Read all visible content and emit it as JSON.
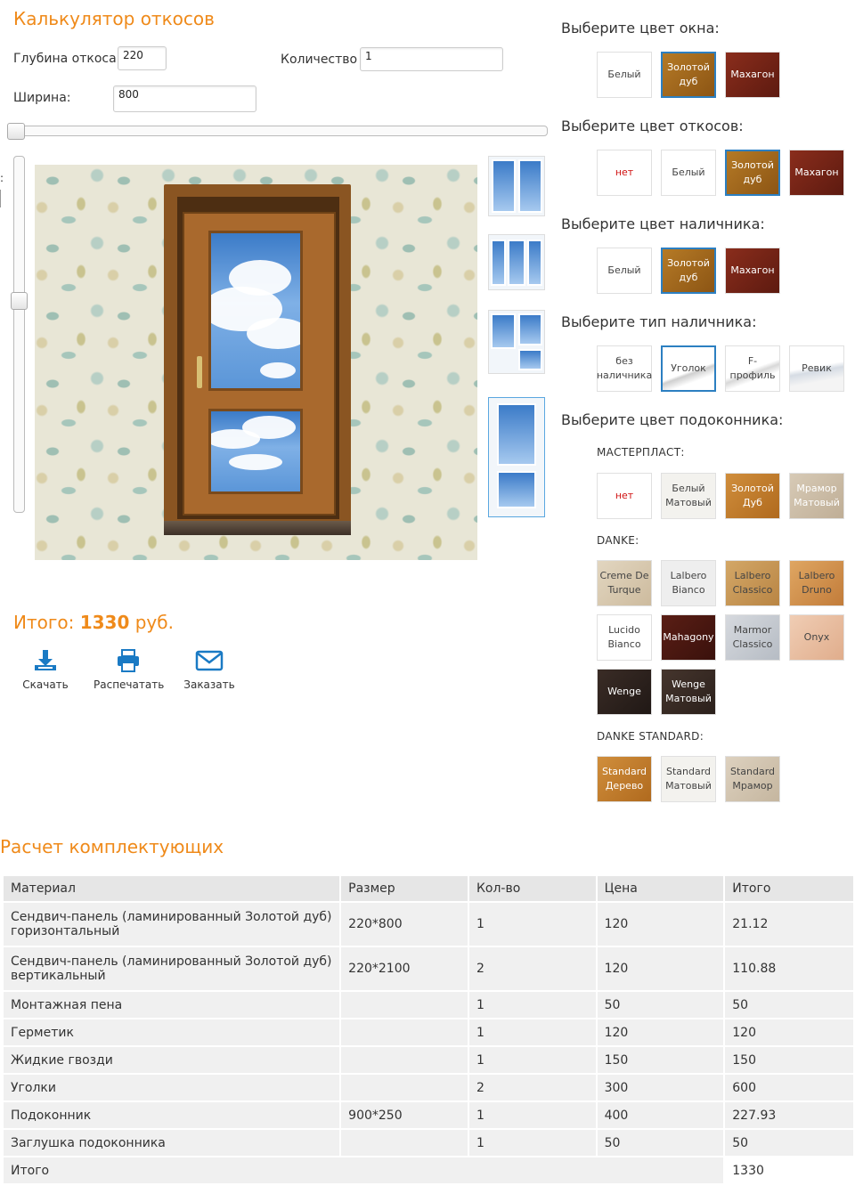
{
  "calculator": {
    "title": "Калькулятор откосов",
    "depth_label": "Глубина откоса",
    "depth_value": "220",
    "quantity_label": "Количество",
    "quantity_value": "1",
    "width_label": "Ширина:",
    "width_value": "800",
    "height_slider_label": ":"
  },
  "totals": {
    "label": "Итого:",
    "amount": "1330",
    "currency": "руб."
  },
  "actions": {
    "download": "Скачать",
    "print": "Распечатать",
    "order": "Заказать"
  },
  "options": {
    "window_color": {
      "title": "Выберите цвет окна:",
      "items": [
        {
          "label": "Белый",
          "color": "#ffffff"
        },
        {
          "label": "Золотой дуб",
          "color": "#a86b1e",
          "selected": true
        },
        {
          "label": "Махагон",
          "color": "#7a2416"
        }
      ]
    },
    "slope_color": {
      "title": "Выберите цвет откосов:",
      "items": [
        {
          "label": "нет",
          "color": "#ffffff"
        },
        {
          "label": "Белый",
          "color": "#ffffff"
        },
        {
          "label": "Золотой дуб",
          "color": "#a86b1e",
          "selected": true
        },
        {
          "label": "Махагон",
          "color": "#7a2416"
        }
      ]
    },
    "trim_color": {
      "title": "Выберите цвет наличника:",
      "items": [
        {
          "label": "Белый",
          "color": "#ffffff"
        },
        {
          "label": "Золотой дуб",
          "color": "#a86b1e",
          "selected": true
        },
        {
          "label": "Махагон",
          "color": "#7a2416"
        }
      ]
    },
    "trim_type": {
      "title": "Выберите тип наличника:",
      "items": [
        {
          "label": "без наличника"
        },
        {
          "label": "Уголок",
          "selected": true
        },
        {
          "label": "F-профиль"
        },
        {
          "label": "Ревик"
        }
      ]
    },
    "sill_color": {
      "title": "Выберите цвет подоконника:",
      "masterplast": {
        "title": "МАСТЕРПЛАСТ:",
        "items": [
          {
            "label": "нет",
            "color": "#ffffff"
          },
          {
            "label": "Белый Матовый",
            "color": "#f3f2ee"
          },
          {
            "label": "Золотой Дуб",
            "color": "#c8822e"
          },
          {
            "label": "Мрамор Матовый",
            "color": "#cfc2ad"
          }
        ]
      },
      "danke": {
        "title": "DANKE:",
        "items": [
          {
            "label": "Creme De Turque",
            "color": "#d8cbb4"
          },
          {
            "label": "Lalbero Bianco",
            "color": "#eeeeee"
          },
          {
            "label": "Lalbero Classico",
            "color": "#c99a5c"
          },
          {
            "label": "Lalbero Druno",
            "color": "#d39a58"
          },
          {
            "label": "Lucido Bianco",
            "color": "#ffffff"
          },
          {
            "label": "Mahagony",
            "color": "#4e1a12"
          },
          {
            "label": "Marmor Classico",
            "color": "#c9ccd1"
          },
          {
            "label": "Onyx",
            "color": "#e9c1a6"
          },
          {
            "label": "Wenge",
            "color": "#2e221d"
          },
          {
            "label": "Wenge Матовый",
            "color": "#3a2c25"
          }
        ]
      },
      "danke_standard": {
        "title": "DANKE STANDARD:",
        "items": [
          {
            "label": "Standard Дерево",
            "color": "#c8822e"
          },
          {
            "label": "Standard Матовый",
            "color": "#f3f2ee"
          },
          {
            "label": "Standard Мрамор",
            "color": "#d5c8b4"
          }
        ]
      }
    }
  },
  "components": {
    "title": "Расчет комплектующих",
    "headers": [
      "Материал",
      "Размер",
      "Кол-во",
      "Цена",
      "Итого"
    ],
    "rows": [
      [
        "Сендвич-панель (ламинированный Золотой дуб) горизонтальный",
        "220*800",
        "1",
        "120",
        "21.12"
      ],
      [
        "Сендвич-панель (ламинированный Золотой дуб) вертикальный",
        "220*2100",
        "2",
        "120",
        "110.88"
      ],
      [
        "Монтажная пена",
        "",
        "1",
        "50",
        "50"
      ],
      [
        "Герметик",
        "",
        "1",
        "120",
        "120"
      ],
      [
        "Жидкие гвозди",
        "",
        "1",
        "150",
        "150"
      ],
      [
        "Уголки",
        "",
        "2",
        "300",
        "600"
      ],
      [
        "Подоконник",
        "900*250",
        "1",
        "400",
        "227.93"
      ],
      [
        "Заглушка подоконника",
        "",
        "1",
        "50",
        "50"
      ]
    ],
    "total_label": "Итого",
    "total_value": "1330"
  }
}
